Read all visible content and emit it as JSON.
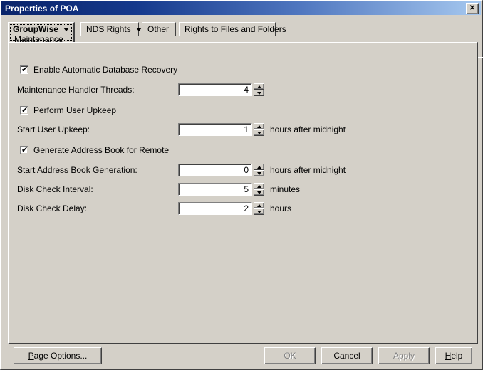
{
  "window": {
    "title": "Properties of POA",
    "close_icon": "close-icon",
    "close_glyph": "✕"
  },
  "tabs": [
    {
      "label": "GroupWise",
      "sublabel": "Maintenance",
      "has_dropdown": true,
      "active": true
    },
    {
      "label": "NDS Rights",
      "has_dropdown": true,
      "active": false
    },
    {
      "label": "Other",
      "has_dropdown": false,
      "active": false
    },
    {
      "label": "Rights to Files and Folders",
      "has_dropdown": false,
      "active": false
    }
  ],
  "form": {
    "checkboxes": [
      {
        "label": "Enable Automatic Database Recovery",
        "checked": true,
        "mark": "✔"
      },
      {
        "label": "Perform User Upkeep",
        "checked": true,
        "mark": "✔"
      },
      {
        "label": "Generate Address Book for Remote",
        "checked": true,
        "mark": "✔"
      }
    ],
    "fields": [
      {
        "label": "Maintenance Handler Threads:",
        "value": "4",
        "suffix": ""
      },
      {
        "label": "Start User Upkeep:",
        "value": "1",
        "suffix": "hours after midnight"
      },
      {
        "label": "Start Address Book Generation:",
        "value": "0",
        "suffix": "hours after midnight"
      },
      {
        "label": "Disk Check Interval:",
        "value": "5",
        "suffix": "minutes"
      },
      {
        "label": "Disk Check Delay:",
        "value": "2",
        "suffix": "hours"
      }
    ]
  },
  "buttons": {
    "page_options": {
      "label": "Page Options...",
      "accel": "P",
      "enabled": true
    },
    "ok": {
      "label": "OK",
      "enabled": false
    },
    "cancel": {
      "label": "Cancel",
      "enabled": true
    },
    "apply": {
      "label": "Apply",
      "enabled": false
    },
    "help": {
      "label": "Help",
      "accel": "H",
      "enabled": true
    }
  },
  "colors": {
    "face": "#d4d0c8",
    "title_left": "#0a246a",
    "title_right": "#a6c8ef",
    "field_bg": "#ffffff",
    "disabled_text": "#808080"
  }
}
